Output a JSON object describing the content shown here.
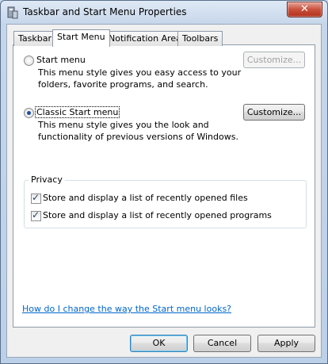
{
  "window": {
    "title": "Taskbar and Start Menu Properties",
    "close_label": "✕"
  },
  "tabs": [
    {
      "label": "Taskbar",
      "active": false
    },
    {
      "label": "Start Menu",
      "active": true
    },
    {
      "label": "Notification Area",
      "active": false
    },
    {
      "label": "Toolbars",
      "active": false
    }
  ],
  "start_menu_option": {
    "label": "Start menu",
    "selected": false,
    "description_line1": "This menu style gives you easy access to your",
    "description_line2": "folders, favorite programs, and search.",
    "customize_label": "Customize...",
    "customize_enabled": false
  },
  "classic_option": {
    "label": "Classic Start menu",
    "selected": true,
    "description_line1": "This menu style gives you the look and",
    "description_line2": "functionality of previous versions of Windows.",
    "customize_label": "Customize...",
    "customize_enabled": true
  },
  "privacy": {
    "title": "Privacy",
    "store_files_label": "Store and display a list of recently opened files",
    "store_files_checked": true,
    "store_programs_label": "Store and display a list of recently opened programs",
    "store_programs_checked": true
  },
  "help_link": "How do I change the way the Start menu looks?",
  "buttons": {
    "ok": "OK",
    "cancel": "Cancel",
    "apply": "Apply"
  },
  "colors": {
    "accent": "#3c7fb1",
    "link": "#0066cc",
    "close": "#c9503d"
  }
}
